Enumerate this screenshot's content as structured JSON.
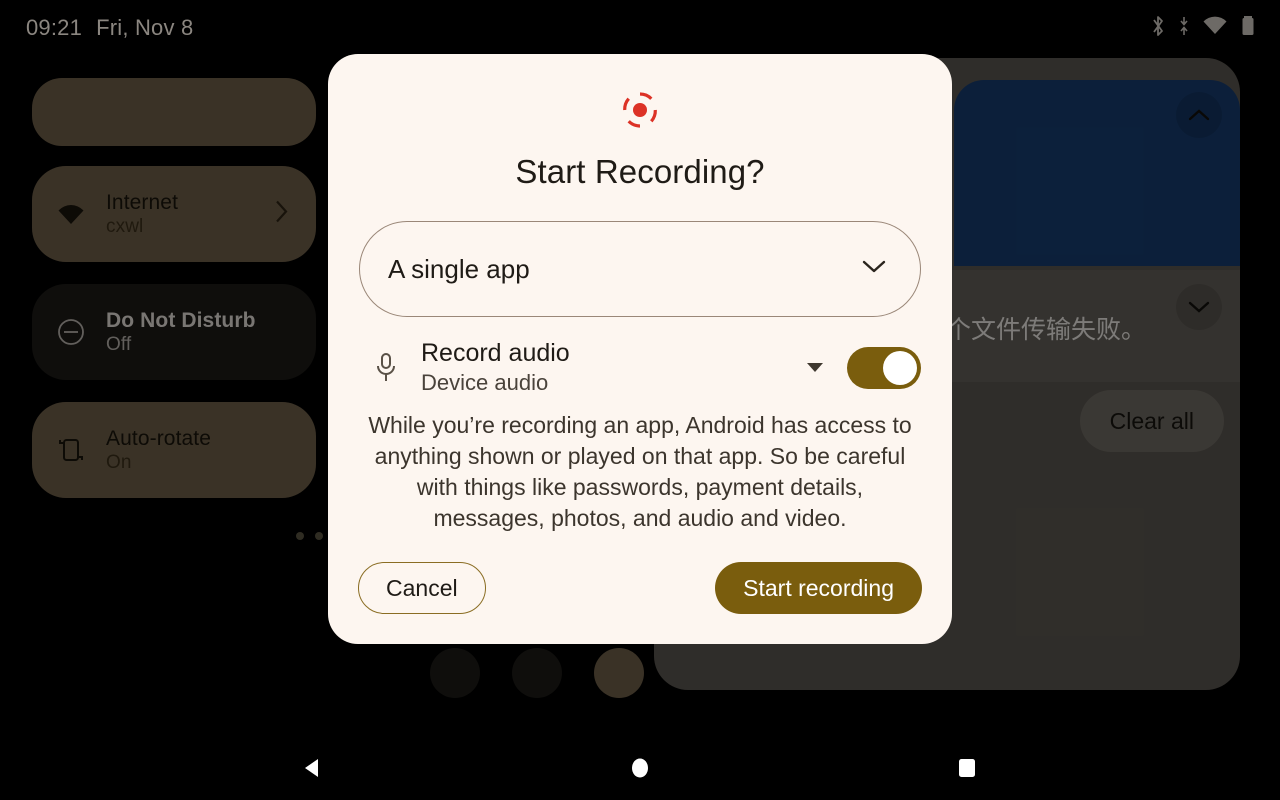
{
  "status_bar": {
    "time": "09:21",
    "date": "Fri, Nov 8",
    "icons": [
      "bluetooth-icon",
      "data-transfer-icon",
      "wifi-icon",
      "battery-icon"
    ]
  },
  "quick_settings": {
    "tiles": [
      {
        "label": "",
        "sub": "",
        "icon": "",
        "state": "blank"
      },
      {
        "label": "Internet",
        "sub": "cxwl",
        "icon": "wifi-icon",
        "state": "active"
      },
      {
        "label": "Do Not Disturb",
        "sub": "Off",
        "icon": "do-not-disturb-icon",
        "state": "inactive"
      },
      {
        "label": "Auto-rotate",
        "sub": "On",
        "icon": "auto-rotate-icon",
        "state": "active"
      }
    ],
    "page_dots": 3
  },
  "notifications": {
    "grey_text": "个文件传输失败。",
    "clear_all_label": "Clear all",
    "collapse_icon": "chevron-up-icon",
    "expand_icon": "chevron-down-icon",
    "blue_card_color": "#163a6b"
  },
  "dialog": {
    "icon": "screen-record-icon",
    "title": "Start Recording?",
    "source_select": {
      "value": "A single app",
      "chevron": "chevron-down-icon"
    },
    "audio": {
      "icon": "microphone-icon",
      "title": "Record audio",
      "subtitle": "Device audio",
      "dropdown_icon": "caret-down-icon",
      "toggle_on": true
    },
    "body": "While you’re recording an app, Android has access to anything shown or played on that app. So be careful with things like passwords, payment details, messages, photos, and audio and video.",
    "cancel_label": "Cancel",
    "start_label": "Start recording"
  },
  "nav_bar": {
    "back": "back-icon",
    "home": "home-icon",
    "recents": "recents-icon"
  },
  "colors": {
    "accent": "#7a5d0d",
    "record_red": "#dc3226",
    "dialog_bg": "#fdf6f0",
    "tile_active": "#6b5c46",
    "tile_inactive": "#1c1a17"
  }
}
